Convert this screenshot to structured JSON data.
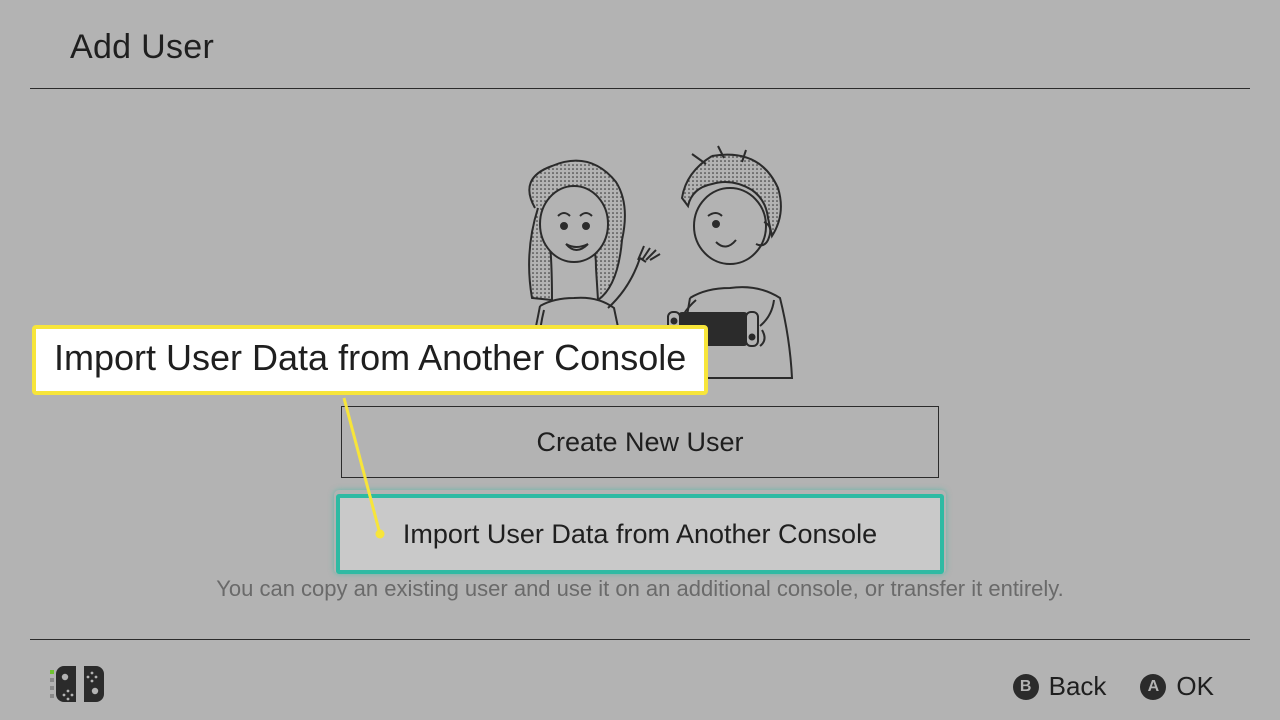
{
  "header": {
    "title": "Add User"
  },
  "buttons": {
    "create": "Create New User",
    "import": "Import User Data from Another Console"
  },
  "hint": "You can copy an existing user and use it on an additional console, or transfer it entirely.",
  "footer": {
    "b_glyph": "B",
    "b_label": "Back",
    "a_glyph": "A",
    "a_label": "OK"
  },
  "callout": {
    "text": "Import User Data from Another Console"
  },
  "colors": {
    "highlight": "#2ebaa3",
    "callout_border": "#f7e53a"
  }
}
